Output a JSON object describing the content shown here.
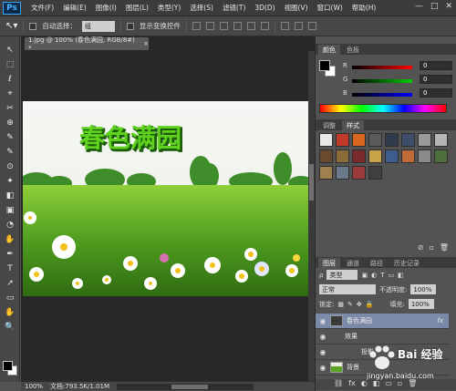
{
  "app": {
    "logo": "Ps",
    "window_controls": [
      "—",
      "□",
      "✕"
    ]
  },
  "menu": [
    "文件(F)",
    "编辑(E)",
    "图像(I)",
    "图层(L)",
    "类型(Y)",
    "选择(S)",
    "滤镜(T)",
    "3D(D)",
    "视图(V)",
    "窗口(W)",
    "帮助(H)"
  ],
  "options": {
    "auto_select_label": "自动选择：",
    "auto_select_value": "组",
    "show_transform_label": "显示变换控件"
  },
  "document": {
    "tab_title": "1.jpg @ 100% (春色满园, RGB/8#) *",
    "close": "×",
    "canvas_text": "春色满园"
  },
  "status": {
    "zoom": "100%",
    "doc_info": "文档:793.5K/1.01M"
  },
  "color_panel": {
    "tabs": [
      "颜色",
      "色板"
    ],
    "sliders": [
      {
        "letter": "R",
        "value": "0",
        "gradient": "#ff0000"
      },
      {
        "letter": "G",
        "value": "0",
        "gradient": "#00cc00"
      },
      {
        "letter": "B",
        "value": "0",
        "gradient": "#0000ff"
      }
    ]
  },
  "styles_panel": {
    "tabs": [
      "调整",
      "样式"
    ],
    "swatches": [
      "#e8e8e8",
      "#c0392b",
      "#d9661f",
      "#5b5b5b",
      "#2f3b4a",
      "#3d4d6b",
      "#9a9a9a",
      "#b5b5b5",
      "#6a4a2e",
      "#8c6b3a",
      "#7a2a2a",
      "#c9a347",
      "#3e5c8c",
      "#c06a3a",
      "#8a8a8a",
      "#4e6e3e",
      "#a08050",
      "#6a7a8a",
      "#9a3a3a",
      "#404040"
    ],
    "footer_icons": [
      "⊘",
      "▫",
      "🗑"
    ]
  },
  "layers_panel": {
    "tabs": [
      "图层",
      "通道",
      "路径",
      "历史记录"
    ],
    "kind_label": "类型",
    "blend_mode": "正常",
    "opacity_label": "不透明度:",
    "opacity_value": "100%",
    "lock_label": "锁定:",
    "fill_label": "填充:",
    "fill_value": "100%",
    "layers": [
      {
        "name": "春色满园",
        "fx": "fx",
        "selected": true
      },
      {
        "name": "效果",
        "sub": true
      },
      {
        "name": "投影",
        "sub2": true
      },
      {
        "name": "背景",
        "bg": true
      }
    ],
    "footer_icons": [
      "⛓",
      "fx",
      "◐",
      "◧",
      "▭",
      "▫",
      "🗑"
    ]
  },
  "watermark": {
    "brand": "Bai 经验",
    "url": "jingyan.baidu.com"
  },
  "tools": [
    "↖",
    "⬚",
    "ℓ",
    "⌖",
    "✂",
    "⊕",
    "✎",
    "✎",
    "⊙",
    "✦",
    "◧",
    "▣",
    "◔",
    "✋",
    "✒",
    "T",
    "↗",
    "▭",
    "✋",
    "🔍"
  ]
}
